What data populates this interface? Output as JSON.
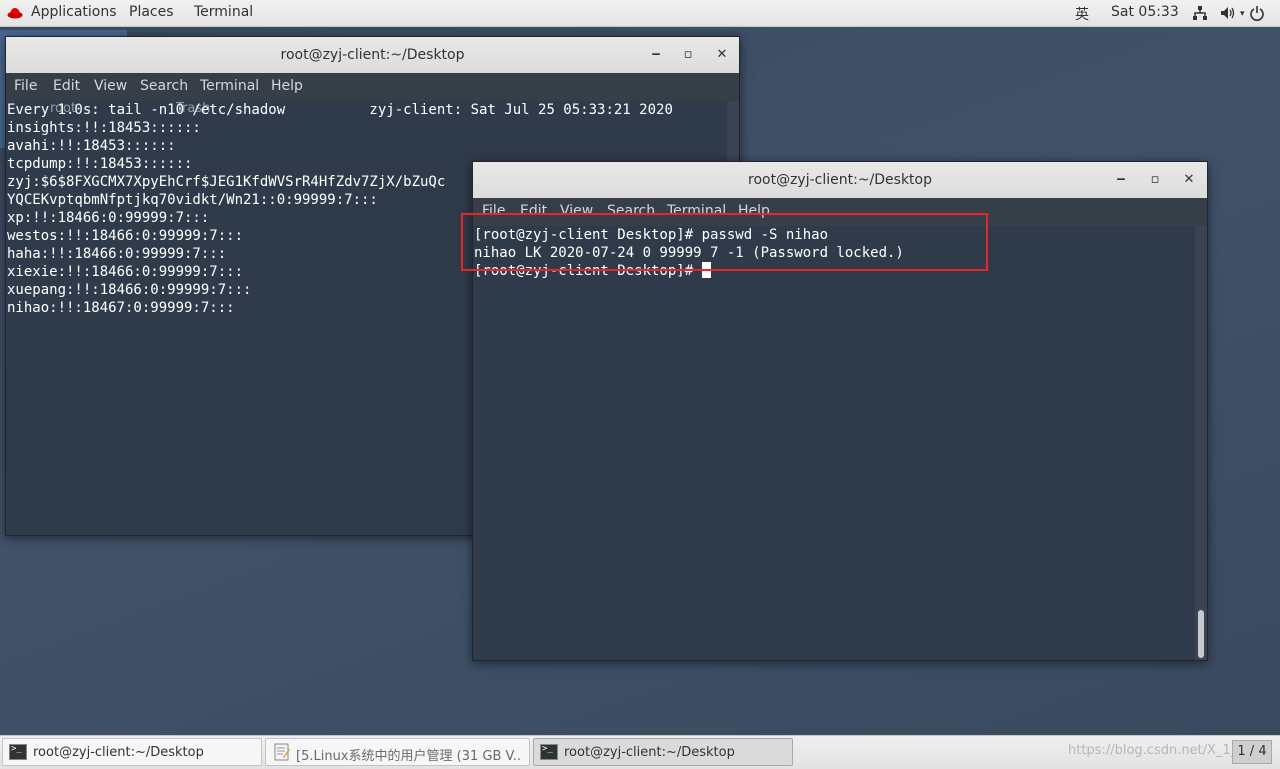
{
  "top_panel": {
    "applications": "Applications",
    "places": "Places",
    "terminal": "Terminal",
    "input_method": "英",
    "clock": "Sat 05:33",
    "tray_icons": [
      "network-icon",
      "volume-icon",
      "power-icon"
    ]
  },
  "desktop": {
    "icons": [
      {
        "label": "root"
      },
      {
        "label": "Trash"
      }
    ]
  },
  "window_back": {
    "title": "root@zyj-client:~/Desktop",
    "menu": [
      "File",
      "Edit",
      "View",
      "Search",
      "Terminal",
      "Help"
    ],
    "lines": [
      "Every 1.0s: tail -n10 /etc/shadow          zyj-client: Sat Jul 25 05:33:21 2020",
      "",
      "insights:!!:18453::::::",
      "avahi:!!:18453::::::",
      "tcpdump:!!:18453::::::",
      "zyj:$6$8FXGCMX7XpyEhCrf$JEG1KfdWVSrR4HfZdv7ZjX/bZuQc",
      "YQCEKvptqbmNfptjkq70vidkt/Wn21::0:99999:7:::",
      "xp:!!:18466:0:99999:7:::",
      "westos:!!:18466:0:99999:7:::",
      "haha:!!:18466:0:99999:7:::",
      "xiexie:!!:18466:0:99999:7:::",
      "xuepang:!!:18466:0:99999:7:::",
      "nihao:!!:18467:0:99999:7:::"
    ]
  },
  "window_front": {
    "title": "root@zyj-client:~/Desktop",
    "menu": [
      "File",
      "Edit",
      "View",
      "Search",
      "Terminal",
      "Help"
    ],
    "lines": [
      "[root@zyj-client Desktop]# passwd -S nihao",
      "nihao LK 2020-07-24 0 99999 7 -1 (Password locked.)"
    ],
    "prompt": "[root@zyj-client Desktop]# "
  },
  "taskbar": {
    "tasks": [
      {
        "label": "root@zyj-client:~/Desktop"
      },
      {
        "label": "[5.Linux系统中的用户管理 (31 GB V..."
      },
      {
        "label": "root@zyj-client:~/Desktop"
      }
    ],
    "watermark": "https://blog.csdn.net/X_1_4",
    "workspace": "1 / 4"
  }
}
